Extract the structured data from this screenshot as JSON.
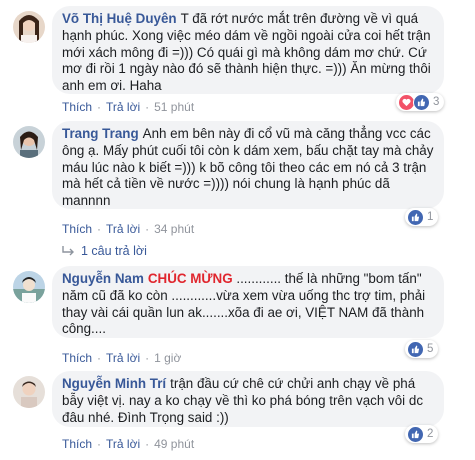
{
  "comments": [
    {
      "name": "Võ Thị Huệ Duyên",
      "text": "T đã rớt nước mắt trên đường về vì quá hạnh phúc. Xong việc méo dám về ngồi ngoài cửa coi hết trận mới xách mông đi =))) Có quái gì mà không dám mơ chứ. Cứ mơ đi rồi 1 ngày nào đó sẽ thành hiện thực. =))) Ăn mừng thôi anh em ơi. Haha",
      "like": "Thích",
      "reply": "Trả lời",
      "time": "51 phút",
      "reaction_count": "3",
      "reaction_icons": [
        "heart-icon",
        "like-icon"
      ]
    },
    {
      "name": "Trang Trang",
      "text": "Anh em bên này đi cổ vũ mà căng thẳng vcc các ông ạ. Mấy phút cuối tôi còn k dám xem, bấu chặt tay mà chảy máu lúc nào k biết =))) k bõ công tôi theo các em nó cả 3 trận mà hết cả tiền về nước =)))) nói chung là hạnh phúc dã mannnn",
      "like": "Thích",
      "reply": "Trả lời",
      "time": "34 phút",
      "reaction_count": "1",
      "reaction_icons": [
        "like-icon"
      ],
      "replies_link": "1 câu trả lời"
    },
    {
      "name": "Nguyễn Nam",
      "shout": "CHÚC MỪNG",
      "text": "............ thế là những \"bom tấn\" năm cũ đã ko còn ............vừa xem vừa uống thc trợ tim, phải thay vài cái quần lun ak.......xõa đi ae ơi, VIỆT NAM đã thành công....",
      "like": "Thích",
      "reply": "Trả lời",
      "time": "1 giờ",
      "reaction_count": "5",
      "reaction_icons": [
        "like-icon"
      ]
    },
    {
      "name": "Nguyễn Minh Trí",
      "text": "trận đầu cứ chê cứ chửi anh chạy về phá bẫy việt vị. nay a ko chạy về thì ko phá bóng trên vạch vôi dc đâu nhé. Đình Trọng said :))",
      "like": "Thích",
      "reply": "Trả lời",
      "time": "49 phút",
      "reaction_count": "2",
      "reaction_icons": [
        "like-icon"
      ]
    }
  ],
  "colors": {
    "link": "#385898",
    "bubble": "#f2f3f5",
    "shout": "#e0262e",
    "like": "#4267b2",
    "heart": "#f25268"
  }
}
